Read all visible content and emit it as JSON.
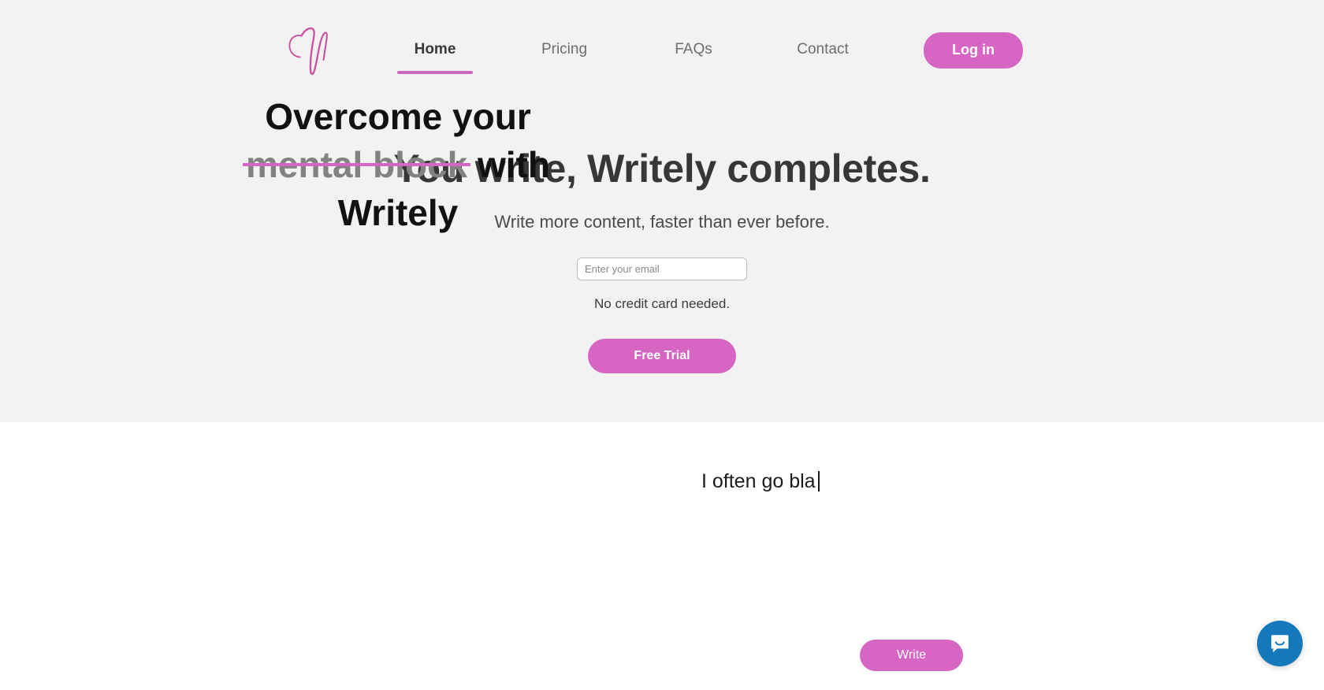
{
  "brand": {
    "logo_name": "writely-script-w-logo",
    "accent_pink": "#d765c3",
    "underline_pink": "#cd66c0",
    "hero_background": "#f2f2f2",
    "chat_blue": "#1578ba"
  },
  "nav": {
    "links": [
      {
        "label": "Home",
        "active": true
      },
      {
        "label": "Pricing",
        "active": false
      },
      {
        "label": "FAQs",
        "active": false
      },
      {
        "label": "Contact",
        "active": false
      }
    ],
    "login_label": "Log in"
  },
  "hero": {
    "title": "You write, Writely completes.",
    "subtitle": "Write more content, faster than ever before.",
    "email_placeholder": "Enter your email",
    "email_value": "",
    "no_card_text": "No credit card needed.",
    "free_trial_label": "Free Trial"
  },
  "features": {
    "heading_part1": "Overcome your",
    "heading_strike": "mental block",
    "heading_part2": "with",
    "heading_part3": "Writely",
    "typed_text": "I often go bla",
    "write_label": "Write"
  },
  "chat": {
    "icon": "chat-bubble-smile-icon",
    "label": "Open chat"
  }
}
